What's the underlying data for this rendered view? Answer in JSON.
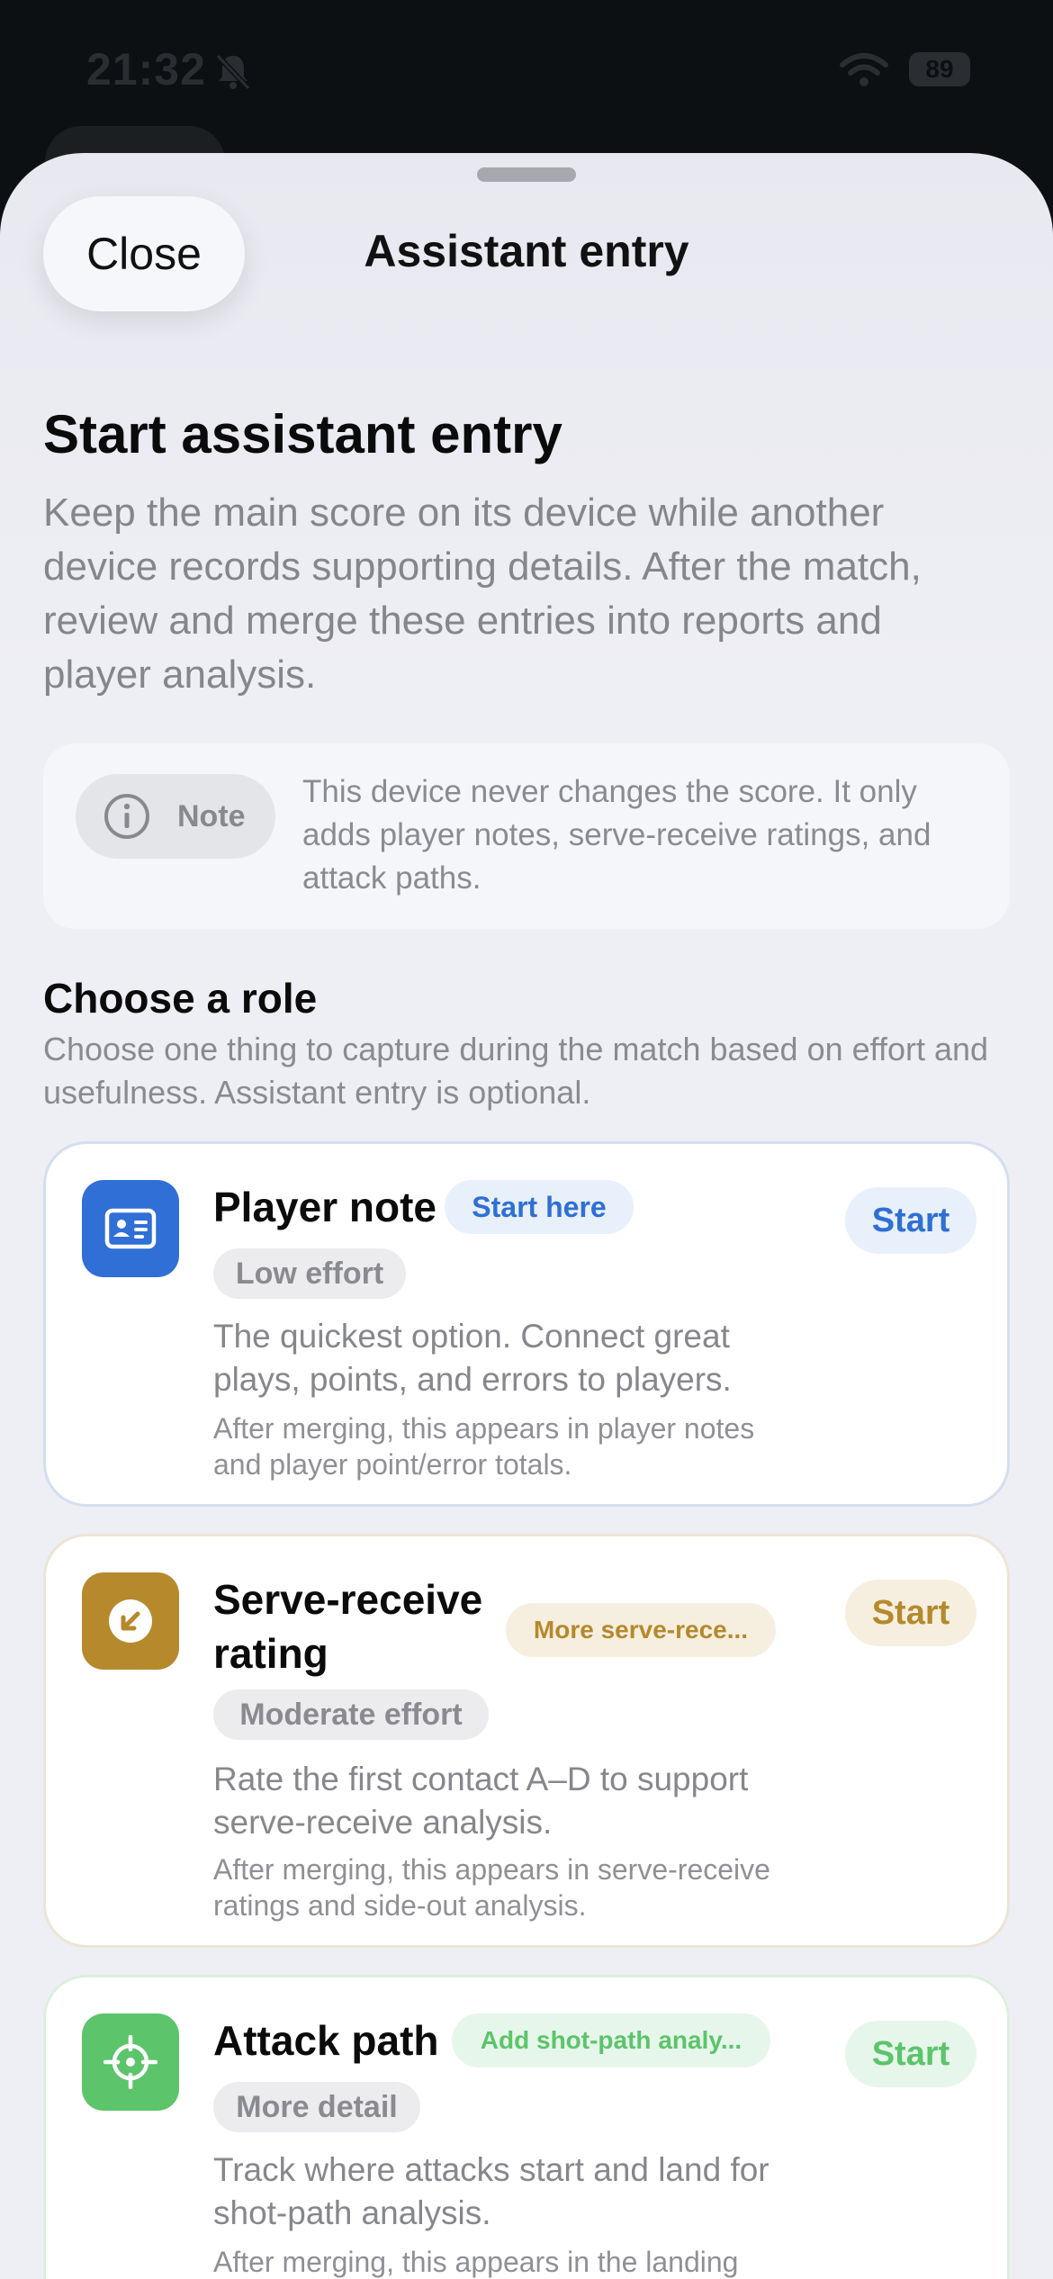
{
  "status_bar": {
    "time": "21:32",
    "battery": "89"
  },
  "header": {
    "close_label": "Close",
    "title": "Assistant entry"
  },
  "intro": {
    "heading": "Start assistant entry",
    "description": "Keep the main score on its device while another device records supporting details. After the match, review and merge these entries into reports and player analysis."
  },
  "note": {
    "label": "Note",
    "text": "This device never changes the score. It only adds player notes, serve-receive ratings, and attack paths."
  },
  "roles_section": {
    "heading": "Choose a role",
    "description": "Choose one thing to capture during the match based on effort and usefulness. Assistant entry is optional."
  },
  "roles": [
    {
      "title": "Player note",
      "tag": "Start here",
      "effort": "Low effort",
      "description": "The quickest option. Connect great plays, points, and errors to players.",
      "merge_note": "After merging, this appears in player notes and player point/error totals.",
      "start_label": "Start",
      "icon": "id-card-icon",
      "accent": "#2f6fd6"
    },
    {
      "title": "Serve-receive rating",
      "tag": "More serve-rece...",
      "effort": "Moderate effort",
      "description": "Rate the first contact A–D to support serve-receive analysis.",
      "merge_note": "After merging, this appears in serve-receive ratings and side-out analysis.",
      "start_label": "Start",
      "icon": "arrow-down-left-icon",
      "accent": "#b5892c"
    },
    {
      "title": "Attack path",
      "tag": "Add shot-path analy...",
      "effort": "More detail",
      "description": "Track where attacks start and land for shot-path analysis.",
      "merge_note": "After merging, this appears in the landing heat map and attack path",
      "start_label": "Start",
      "icon": "crosshair-icon",
      "accent": "#5cc46b"
    }
  ]
}
